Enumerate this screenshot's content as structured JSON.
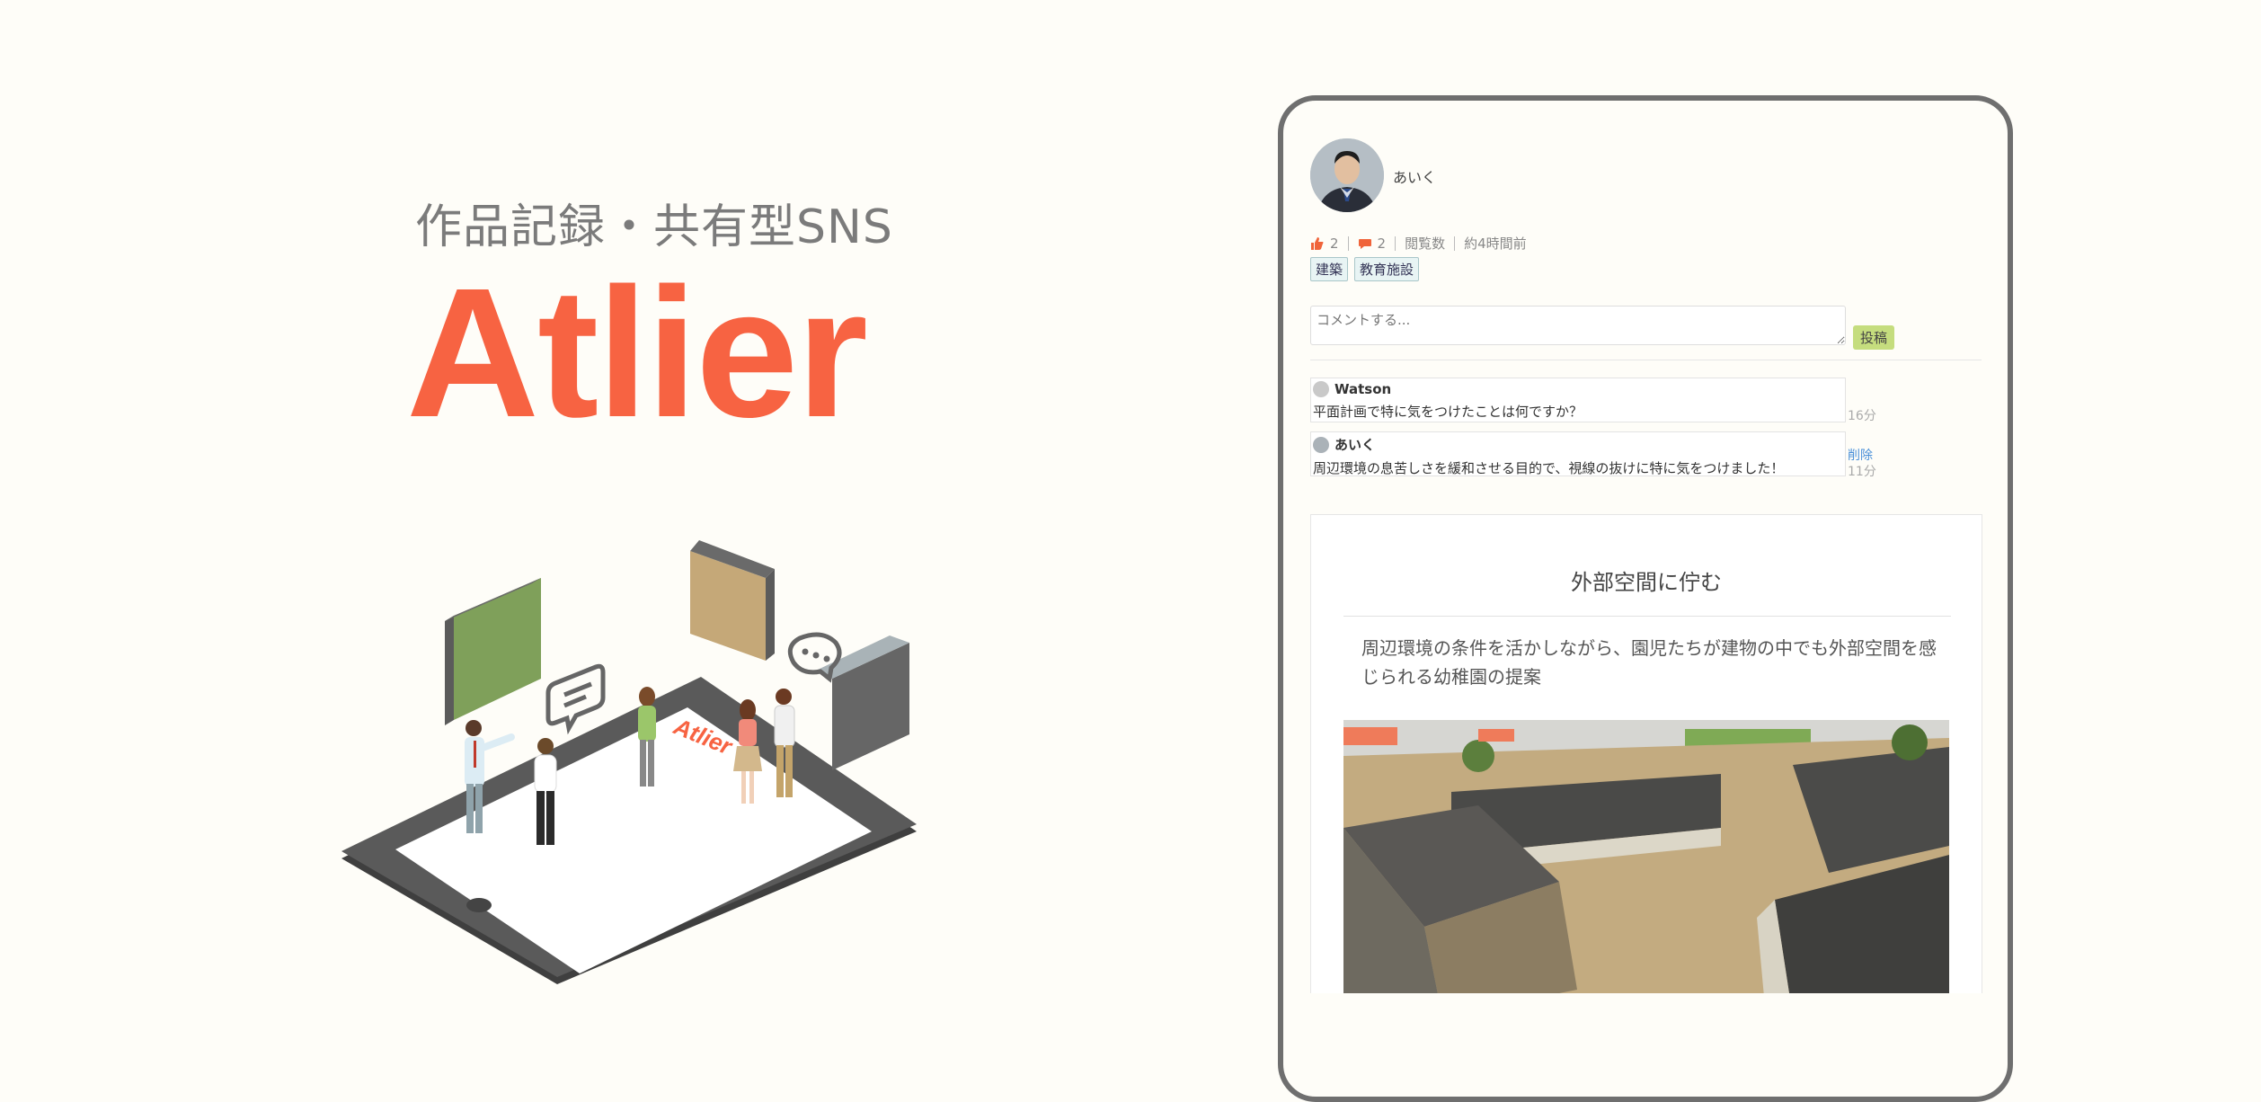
{
  "hero": {
    "subtitle": "作品記録・共有型SNS",
    "title": "Atlier",
    "screen_logo": "Atlier"
  },
  "post": {
    "username": "あいく",
    "likes": "2",
    "comments_count": "2",
    "views_label": "閲覧数",
    "posted_ago": "約4時間前",
    "tags": [
      "建築",
      "教育施設"
    ],
    "comment_placeholder": "コメントする...",
    "post_button": "投稿",
    "comments": [
      {
        "author": "Watson",
        "text": "平面計画で特に気をつけたことは何ですか？",
        "time": "16分"
      },
      {
        "author": "あいく",
        "text": "周辺環境の息苦しさを緩和させる目的で、視線の抜けに特に気をつけました！",
        "time": "11分",
        "delete_label": "削除"
      }
    ],
    "work": {
      "title": "外部空間に佇む",
      "description": "周辺環境の条件を活かしながら、園児たちが建物の中でも外部空間を感じられる幼稚園の提案"
    }
  },
  "colors": {
    "brand": "#f76342",
    "like_icon": "#f0643a",
    "comment_icon": "#f0643a",
    "post_button": "#c5dd7e",
    "delete_link": "#4a90d9"
  },
  "icons": [
    "thumbs-up-icon",
    "speech-bubble-icon",
    "avatar-photo"
  ]
}
